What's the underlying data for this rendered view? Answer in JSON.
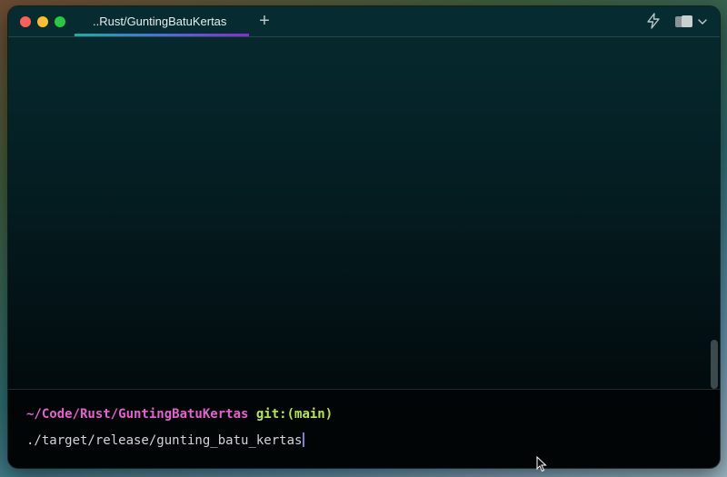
{
  "window": {
    "tab_title": "..Rust/GuntingBatuKertas",
    "new_tab_symbol": "+"
  },
  "terminal": {
    "prompt_path": "~/Code/Rust/GuntingBatuKertas",
    "prompt_git": "git:(main)",
    "command": "./target/release/gunting_batu_kertas"
  },
  "icons": {
    "close": "close-icon",
    "minimize": "minimize-icon",
    "maximize": "maximize-icon",
    "bolt": "lightning-bolt-icon",
    "panes": "panes-icon",
    "chevron": "chevron-down-icon"
  },
  "colors": {
    "path": "#e85fd0",
    "git": "#b4e84b",
    "accent_gradient_start": "#1ab0a0",
    "accent_gradient_end": "#8b2bd1"
  }
}
